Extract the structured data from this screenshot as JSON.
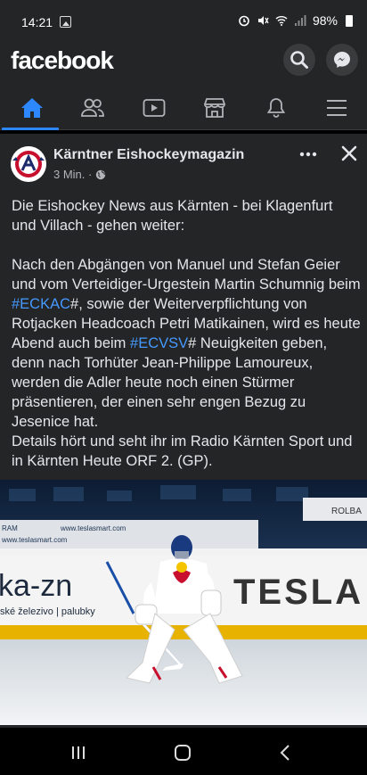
{
  "status": {
    "time": "14:21",
    "battery": "98%"
  },
  "header": {
    "logo": "facebook",
    "icons": {
      "search": "search-icon",
      "messenger": "messenger-icon"
    }
  },
  "tabs": [
    {
      "name": "home",
      "icon": "home-icon",
      "active": true
    },
    {
      "name": "friends",
      "icon": "friends-icon"
    },
    {
      "name": "watch",
      "icon": "video-icon"
    },
    {
      "name": "marketplace",
      "icon": "marketplace-icon"
    },
    {
      "name": "notifications",
      "icon": "bell-icon"
    },
    {
      "name": "menu",
      "icon": "menu-icon"
    }
  ],
  "post": {
    "author": "Kärntner Eishockeymagazin",
    "time": "3 Min. ·",
    "text": {
      "intro": "Die Eishockey News aus Kärnten - bei Klagenfurt und Villach - gehen weiter:",
      "part1": "Nach den Abgängen von Manuel und Stefan Geier und vom Verteidiger-Urgestein Martin Schumnig beim ",
      "hashtag1": "#ECKAC",
      "part2": "#, sowie der Weiterverpflichtung von Rotjacken Headcoach Petri Matikainen, wird es heute Abend auch beim ",
      "hashtag2": "#ECVSV",
      "part3": "# Neuigkeiten geben, denn nach Torhüter Jean-Philippe Lamoureux, werden die Adler heute noch einen Stürmer präsentieren, der einen sehr engen Bezug zu Jesenice hat.",
      "part4": "Details hört und seht ihr im Radio Kärnten Sport und in Kärnten Heute ORF 2. (GP)."
    },
    "image": {
      "board_left": "ka-zn",
      "board_left_sub": "ské železivo | palubky",
      "board_right": "TESLA",
      "ad_small": "www.teslasmart.com",
      "ad_small_2": "RAM",
      "ad_top_right": "ROLBA"
    }
  },
  "colors": {
    "link": "#4599ff",
    "accent": "#2d88ff",
    "surface": "#242526"
  }
}
